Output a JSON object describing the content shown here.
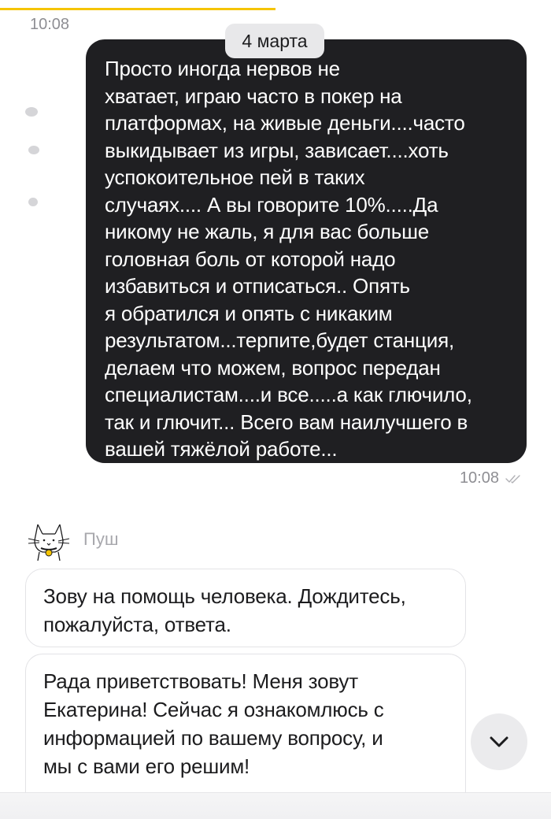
{
  "status": {
    "time": "10:08"
  },
  "chat": {
    "date_divider": "4 марта",
    "outgoing": {
      "lines": [
        "Просто иногда нервов не",
        "хватает, играю часто в покер на",
        "платформах, на живые деньги....часто",
        "выкидывает из игры, зависает....хоть",
        "успокоительное пей в таких",
        "случаях.... А вы говорите 10%.....Да",
        "никому не жаль, я для вас больше",
        "головная боль от которой надо",
        "избавиться и отписаться.. Опять",
        "я обратился и опять с никаким",
        "результатом...терпите,будет станция,",
        "делаем что можем, вопрос передан",
        "специалистам....и все.....а как глючило,",
        "так и глючит... Всего вам наилучшего в",
        "вашей тяжёлой работе..."
      ],
      "time": "10:08",
      "status_icon": "double-check-icon"
    },
    "bot": {
      "name": "Пуш",
      "avatar_icon": "cat-avatar-icon"
    },
    "incoming": [
      {
        "lines": [
          "Зову на помощь человека. Дождитесь,",
          "пожалуйста, ответа."
        ]
      },
      {
        "lines": [
          "Рада приветствовать! Меня зовут",
          "Екатерина! Сейчас я ознакомлюсь с",
          "информацией по вашему вопросу, и",
          "мы с вами его решим!"
        ]
      }
    ],
    "scroll_button_icon": "chevron-down-icon"
  },
  "colors": {
    "accent": "#f5c400",
    "outgoing_bubble": "#1f1f22",
    "muted_text": "#8e8e93"
  }
}
